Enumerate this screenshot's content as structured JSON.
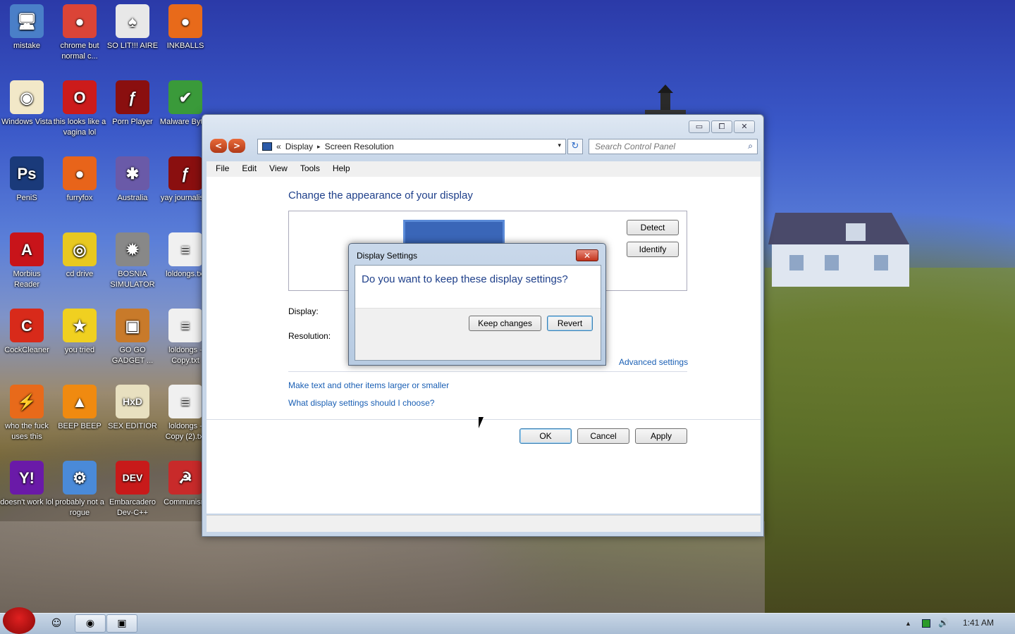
{
  "desktop_icons": [
    {
      "label": "mistake",
      "icon": "computer-icon",
      "color": "#4a7fc8",
      "glyph": "🖥"
    },
    {
      "label": "chrome but normal c...",
      "icon": "chrome-icon",
      "color": "#db4437",
      "glyph": "●"
    },
    {
      "label": "SO LIT!!! AIRE",
      "icon": "cards-icon",
      "color": "#e8e8e8",
      "glyph": "♠"
    },
    {
      "label": "INKBALLS",
      "icon": "inkball-icon",
      "color": "#e86a1a",
      "glyph": "●"
    },
    {
      "label": "Windows Vista",
      "icon": "egg-icon",
      "color": "#f2e8c8",
      "glyph": "◉"
    },
    {
      "label": "this looks like a vagina lol",
      "icon": "opera-icon",
      "color": "#cc1b1b",
      "glyph": "O"
    },
    {
      "label": "Porn Player",
      "icon": "flash-icon",
      "color": "#8a0f0f",
      "glyph": "ƒ"
    },
    {
      "label": "Malware Bytes",
      "icon": "shield-icon",
      "color": "#3a9a3a",
      "glyph": "✔"
    },
    {
      "label": "PeniS",
      "icon": "photoshop-icon",
      "color": "#1a3a7a",
      "glyph": "Ps"
    },
    {
      "label": "furryfox",
      "icon": "firefox-icon",
      "color": "#e8641a",
      "glyph": "●"
    },
    {
      "label": "Australia",
      "icon": "spider-icon",
      "color": "#6a5aa8",
      "glyph": "✱"
    },
    {
      "label": "yay journalism",
      "icon": "flash-icon",
      "color": "#8a0f0f",
      "glyph": "ƒ"
    },
    {
      "label": "Morbius Reader",
      "icon": "acrobat-icon",
      "color": "#c8141a",
      "glyph": "A"
    },
    {
      "label": "cd drive",
      "icon": "cd-icon",
      "color": "#e8c820",
      "glyph": "◎"
    },
    {
      "label": "BOSNIA SIMULATOR",
      "icon": "mine-icon",
      "color": "#888888",
      "glyph": "✹"
    },
    {
      "label": "loldongs.txt",
      "icon": "text-file-icon",
      "color": "#f0f0f0",
      "glyph": "≡"
    },
    {
      "label": "CockCleaner",
      "icon": "ccleaner-icon",
      "color": "#d82a1a",
      "glyph": "C"
    },
    {
      "label": "you tried",
      "icon": "star-icon",
      "color": "#f0d020",
      "glyph": "★"
    },
    {
      "label": "GO GO GADGET ...",
      "icon": "briefcase-icon",
      "color": "#c87a2a",
      "glyph": "▣"
    },
    {
      "label": "loldongs - Copy.txt",
      "icon": "text-file-icon",
      "color": "#f0f0f0",
      "glyph": "≡"
    },
    {
      "label": "who the fuck uses this",
      "icon": "winamp-icon",
      "color": "#e86a1a",
      "glyph": "⚡"
    },
    {
      "label": "BEEP BEEP",
      "icon": "vlc-icon",
      "color": "#f08a10",
      "glyph": "▲"
    },
    {
      "label": "SEX EDITIOR",
      "icon": "hxd-icon",
      "color": "#e8e0c0",
      "glyph": "HxD"
    },
    {
      "label": "loldongs - Copy (2).txt",
      "icon": "text-file-icon",
      "color": "#f0f0f0",
      "glyph": "≡"
    },
    {
      "label": "doesn't work lol",
      "icon": "yahoo-icon",
      "color": "#6a1aa8",
      "glyph": "Y!"
    },
    {
      "label": "probably not a rogue",
      "icon": "settings-icon",
      "color": "#4a8ad8",
      "glyph": "⚙"
    },
    {
      "label": "Embarcadero Dev-C++",
      "icon": "devcpp-icon",
      "color": "#c81a1a",
      "glyph": "DEV"
    },
    {
      "label": "Communism",
      "icon": "communism-icon",
      "color": "#c82a2a",
      "glyph": "☭"
    }
  ],
  "window": {
    "caption_buttons": {
      "minimize": "▭",
      "maximize": "⧠",
      "close": "✕"
    },
    "nav": {
      "back": "<",
      "forward": ">"
    },
    "address": {
      "prefix": "«",
      "crumbs": [
        "Display",
        "Screen Resolution"
      ],
      "sep": "▸",
      "dropdown": "▾"
    },
    "refresh": "↻",
    "search": {
      "placeholder": "Search Control Panel",
      "icon": "🔍"
    },
    "menu": [
      "File",
      "Edit",
      "View",
      "Tools",
      "Help"
    ],
    "heading": "Change the appearance of your display",
    "detect": "Detect",
    "identify": "Identify",
    "display_label": "Display:",
    "resolution_label": "Resolution:",
    "advanced": "Advanced settings",
    "link1": "Make text and other items larger or smaller",
    "link2": "What display settings should I choose?",
    "ok": "OK",
    "cancel": "Cancel",
    "apply": "Apply"
  },
  "dialog": {
    "title": "Display Settings",
    "close": "✕",
    "question": "Do you want to keep these display settings?",
    "keep": "Keep changes",
    "revert": "Revert"
  },
  "taskbar": {
    "items": [
      {
        "icon": "explorer-icon",
        "glyph": "☺"
      },
      {
        "icon": "chrome-icon",
        "glyph": "◉"
      },
      {
        "icon": "display-settings-icon",
        "glyph": "▣"
      }
    ],
    "tray_up": "▲",
    "clock": "1:41 AM"
  }
}
